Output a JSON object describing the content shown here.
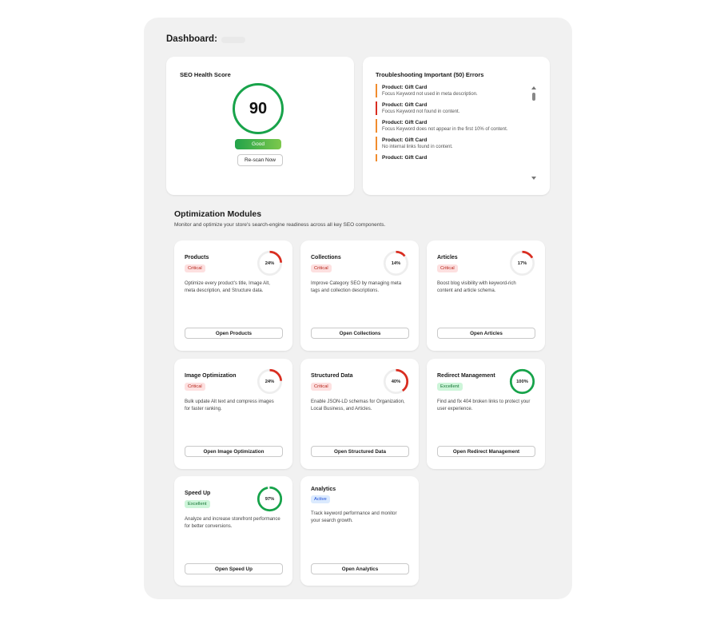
{
  "dashboard": {
    "title": "Dashboard:"
  },
  "seo": {
    "title": "SEO Health Score",
    "score": "90",
    "status": "Good",
    "rescan_label": "Re-scan Now"
  },
  "errors": {
    "title": "Troubleshooting Important (50) Errors",
    "items": [
      {
        "title": "Product: Gift Card",
        "desc": "Focus Keyword not used in meta description.",
        "color": "#f08c2e"
      },
      {
        "title": "Product: Gift Card",
        "desc": "Focus Keyword not found in content.",
        "color": "#d92d20"
      },
      {
        "title": "Product: Gift Card",
        "desc": "Focus Keyword does not appear in the first 10% of content.",
        "color": "#f08c2e"
      },
      {
        "title": "Product: Gift Card",
        "desc": "No internal links found in content.",
        "color": "#f08c2e"
      },
      {
        "title": "Product: Gift Card",
        "desc": "",
        "color": "#f08c2e"
      }
    ]
  },
  "modules_section": {
    "title": "Optimization Modules",
    "description": "Monitor and optimize your store's search-engine readiness across all key SEO components."
  },
  "modules": [
    {
      "title": "Products",
      "status": "Critical",
      "status_type": "critical",
      "percent": 24,
      "percent_label": "24%",
      "description": "Optimize every product's title, Image Alt, meta description, and Structure data.",
      "button": "Open Products"
    },
    {
      "title": "Collections",
      "status": "Critical",
      "status_type": "critical",
      "percent": 14,
      "percent_label": "14%",
      "description": "Improve Category SEO by managing meta tags and collection descriptions.",
      "button": "Open Collections"
    },
    {
      "title": "Articles",
      "status": "Critical",
      "status_type": "critical",
      "percent": 17,
      "percent_label": "17%",
      "description": "Boost blog visibility with keyword-rich content and article schema.",
      "button": "Open Articles"
    },
    {
      "title": "Image Optimization",
      "status": "Critical",
      "status_type": "critical",
      "percent": 24,
      "percent_label": "24%",
      "description": "Bulk update Alt text and compress images for faster ranking.",
      "button": "Open Image Optimization"
    },
    {
      "title": "Structured Data",
      "status": "Critical",
      "status_type": "critical",
      "percent": 40,
      "percent_label": "40%",
      "description": "Enable JSON-LD schemas for Organization, Local Business, and Articles.",
      "button": "Open Structured Data"
    },
    {
      "title": "Redirect Management",
      "status": "Excellent",
      "status_type": "excellent",
      "percent": 100,
      "percent_label": "100%",
      "description": "Find and fix 404 broken links to protect your user experience.",
      "button": "Open Redirect Management"
    },
    {
      "title": "Speed Up",
      "status": "Excellent",
      "status_type": "excellent",
      "percent": 97,
      "percent_label": "97%",
      "description": "Analyze and increase storefront performance for better conversions.",
      "button": "Open Speed Up"
    },
    {
      "title": "Analytics",
      "status": "Active",
      "status_type": "active",
      "description": "Track keyword performance and monitor your search growth.",
      "button": "Open Analytics"
    }
  ],
  "colors": {
    "critical": "#d92d20",
    "excellent": "#16a34a",
    "track": "#eeeeee",
    "good": "#18a34a"
  }
}
